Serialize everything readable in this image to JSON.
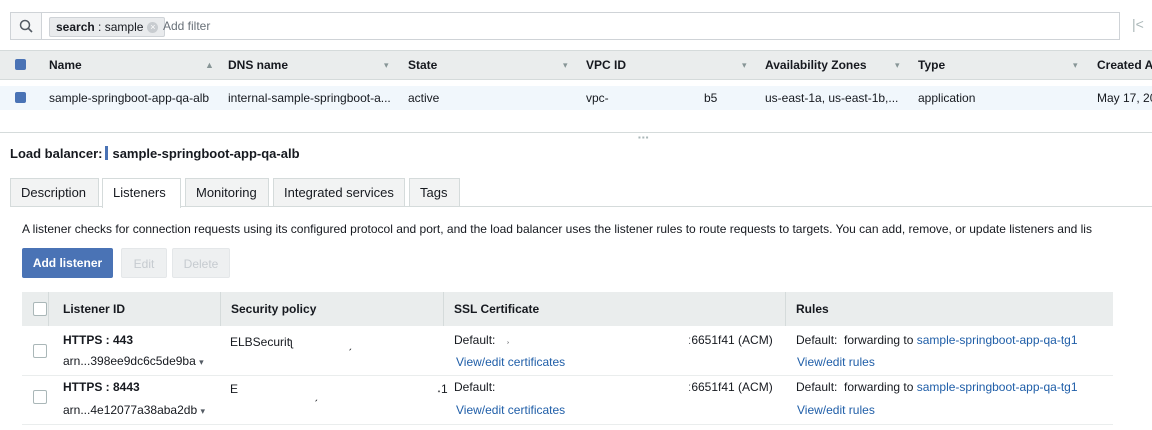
{
  "search": {
    "filter_key": "search",
    "filter_sep": " : ",
    "filter_value": "sample",
    "add_filter_placeholder": "Add filter",
    "pager_glyph": "|<"
  },
  "lb_table": {
    "headers": [
      "Name",
      "DNS name",
      "State",
      "VPC ID",
      "Availability Zones",
      "Type",
      "Created A"
    ],
    "row": {
      "name": "sample-springboot-app-qa-alb",
      "dns": "internal-sample-springboot-a...",
      "state": "active",
      "vpc_prefix": "vpc-",
      "vpc_suffix": "b5",
      "azs": "us-east-1a, us-east-1b,...",
      "type": "application",
      "created": "May 17, 20"
    }
  },
  "detail": {
    "label": "Load balancer:",
    "name": "sample-springboot-app-qa-alb",
    "tabs": [
      "Description",
      "Listeners",
      "Monitoring",
      "Integrated services",
      "Tags"
    ],
    "active_tab": "Listeners",
    "description": "A listener checks for connection requests using its configured protocol and port, and the load balancer uses the listener rules to route requests to targets. You can add, remove, or update listeners and lis",
    "buttons": {
      "add": "Add listener",
      "edit": "Edit",
      "delete": "Delete"
    }
  },
  "listeners": {
    "headers": [
      "Listener ID",
      "Security policy",
      "SSL Certificate",
      "Rules"
    ],
    "rows": [
      {
        "protocol": "HTTPS : 443",
        "arn": "arn...398ee9dc6c5de9ba",
        "policy": "ELBSecuritʅ",
        "policy_mark": "ˏ",
        "ssl_default": "Default:",
        "ssl_mid": "˒",
        "ssl_cert": "ː6651f41 (ACM)",
        "ssl_link": "View/edit certificates",
        "rules_default": "Default:",
        "rules_text": "forwarding to",
        "rules_target": "sample-springboot-app-qa-tg1",
        "rules_link": "View/edit rules"
      },
      {
        "protocol": "HTTPS : 8443",
        "arn": "arn...4e12077a38aba2db",
        "policy": "E",
        "policy_mark": "ˏ",
        "policy_tail": "˔1",
        "ssl_default": "Default:",
        "ssl_mid": "",
        "ssl_cert": "ː6651f41 (ACM)",
        "ssl_link": "View/edit certificates",
        "rules_default": "Default:",
        "rules_text": "forwarding to",
        "rules_target": "sample-springboot-app-qa-tg1",
        "rules_link": "View/edit rules"
      }
    ]
  },
  "colors": {
    "accent": "#4a73b5",
    "link": "#1f5ea8",
    "header_bg": "#eaeded"
  },
  "icons": {
    "search": "search-icon",
    "clear": "close-icon",
    "sort": "sort-caret-icon",
    "dropdown": "caret-down-icon"
  }
}
